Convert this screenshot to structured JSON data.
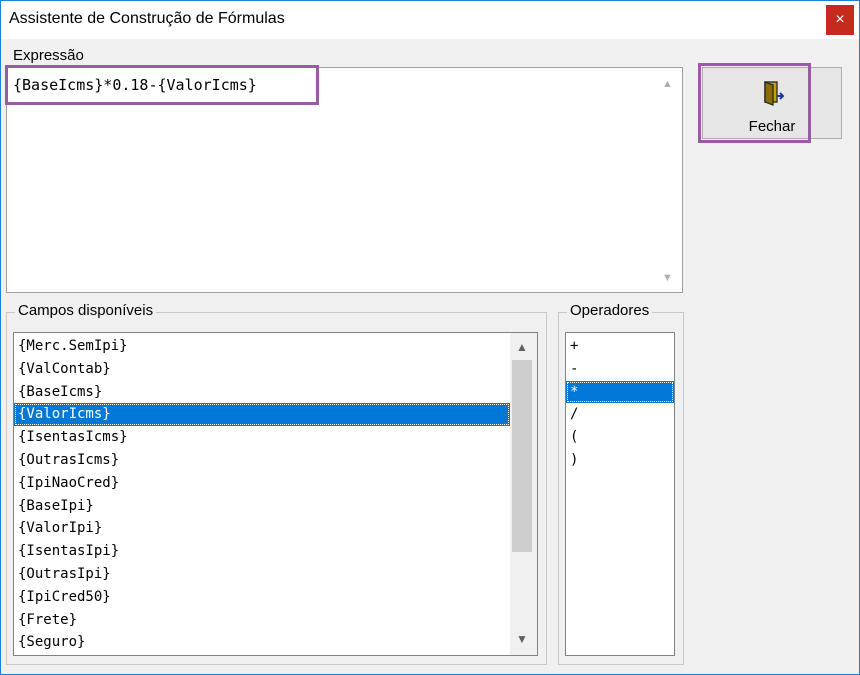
{
  "window": {
    "title": "Assistente de Construção de Fórmulas",
    "close_glyph": "×"
  },
  "expression": {
    "label": "Expressão",
    "value": "{BaseIcms}*0.18-{ValorIcms}"
  },
  "fechar_button": {
    "label": "Fechar",
    "icon": "door-exit-icon"
  },
  "fields": {
    "label": "Campos disponíveis",
    "items": [
      "{Merc.SemIpi}",
      "{ValContab}",
      "{BaseIcms}",
      "{ValorIcms}",
      "{IsentasIcms}",
      "{OutrasIcms}",
      "{IpiNaoCred}",
      "{BaseIpi}",
      "{ValorIpi}",
      "{IsentasIpi}",
      "{OutrasIpi}",
      "{IpiCred50}",
      "{Frete}",
      "{Seguro}"
    ],
    "selected_index": 3
  },
  "operators": {
    "label": "Operadores",
    "items": [
      "+",
      "-",
      "*",
      "/",
      "(",
      ")"
    ],
    "selected_index": 2
  },
  "colors": {
    "selection": "#0078d7",
    "highlight_border": "#9a5aa5",
    "close_button": "#c42b1c"
  }
}
